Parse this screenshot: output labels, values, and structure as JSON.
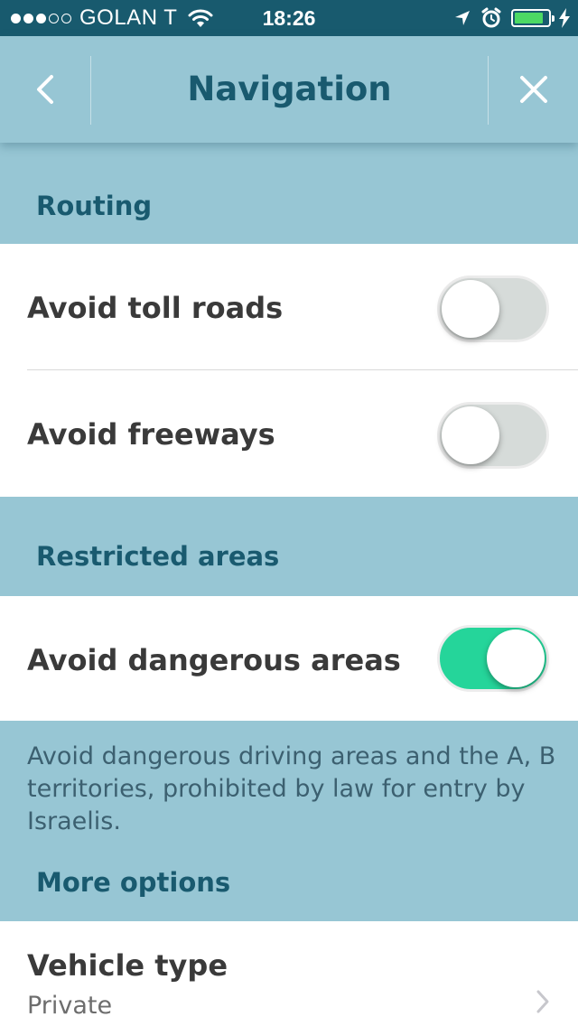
{
  "status_bar": {
    "carrier": "GOLAN T",
    "time": "18:26",
    "signal_full": 3,
    "signal_total": 5,
    "battery_level": 0.85,
    "battery_color": "#4cd964",
    "icons": [
      "wifi-icon",
      "location-arrow-icon",
      "alarm-icon",
      "battery-icon",
      "charging-bolt-icon"
    ]
  },
  "nav": {
    "title": "Navigation",
    "back_icon": "chevron-left-icon",
    "close_icon": "close-icon"
  },
  "colors": {
    "background": "#97c6d4",
    "status_bar": "#185a6e",
    "title_text": "#195a6f",
    "toggle_on": "#25d59a",
    "toggle_off": "#d6dbd9"
  },
  "sections": {
    "routing": "Routing",
    "restricted": "Restricted areas",
    "more": "More options"
  },
  "settings": {
    "avoid_toll": {
      "label": "Avoid toll roads",
      "enabled": false
    },
    "avoid_freeways": {
      "label": "Avoid freeways",
      "enabled": false
    },
    "avoid_dangerous": {
      "label": "Avoid dangerous areas",
      "enabled": true
    }
  },
  "restricted_description": "Avoid dangerous driving areas and the A, B territories, prohibited by law for entry by Israelis.",
  "vehicle": {
    "label": "Vehicle type",
    "value": "Private",
    "chevron_icon": "chevron-right-icon"
  }
}
